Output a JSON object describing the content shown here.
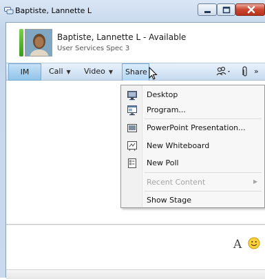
{
  "window": {
    "title": "Baptiste, Lannette L"
  },
  "contact": {
    "name": "Baptiste, Lannette L - Available",
    "title": "User Services Spec 3"
  },
  "toolbar": {
    "im_label": "IM",
    "call_label": "Call",
    "video_label": "Video",
    "share_label": "Share",
    "more_label": "»"
  },
  "share_menu": {
    "items": [
      {
        "label": "Desktop",
        "icon": "monitor-icon"
      },
      {
        "label": "Program...",
        "icon": "program-window-icon"
      },
      {
        "label": "PowerPoint Presentation...",
        "icon": "powerpoint-icon"
      },
      {
        "label": "New Whiteboard",
        "icon": "whiteboard-icon"
      },
      {
        "label": "New Poll",
        "icon": "poll-icon"
      },
      {
        "label": "Recent Content",
        "disabled": true,
        "has_submenu": true
      },
      {
        "label": "Show Stage"
      }
    ]
  },
  "compose": {
    "font_label": "A"
  },
  "colors": {
    "presence_available": "#4caf26",
    "accent": "#8fc3ea",
    "close_button": "#c9462f"
  }
}
